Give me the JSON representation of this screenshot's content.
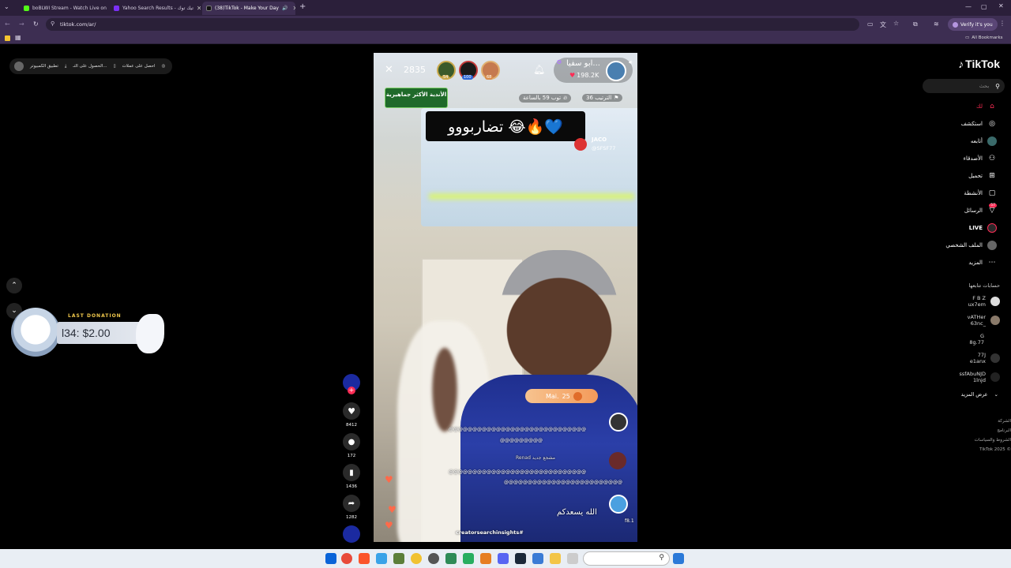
{
  "browser": {
    "tabs": [
      {
        "title": "boBLWI Stream - Watch Live on",
        "fav_color": "#53fc18"
      },
      {
        "title": "Yahoo Search Results - تيك توك",
        "fav_color": "#7b2ff7"
      },
      {
        "title": "(38)TikTok - Make Your Day",
        "fav_color": "#111111"
      }
    ],
    "url": "tiktok.com/ar/",
    "verify_label": "Verify it's you",
    "all_bookmarks": "All Bookmarks"
  },
  "top_actions": {
    "points": "احصل على عملات",
    "get_app": "الحصول على التـ...",
    "desktop_app": "تطبيق الكمبيوتر"
  },
  "donation": {
    "title": "LAST DONATION",
    "amount": "l34: $2.00"
  },
  "sidebar": {
    "brand": "TikTok",
    "search_placeholder": "بحث",
    "nav": [
      {
        "label": "لك",
        "icon": "home-icon"
      },
      {
        "label": "استكشف",
        "icon": "compass-icon"
      },
      {
        "label": "أتابعه",
        "icon": "following-icon"
      },
      {
        "label": "الأصدقاء",
        "icon": "friends-icon"
      },
      {
        "label": "تحميل",
        "icon": "upload-icon"
      },
      {
        "label": "الأنشطة",
        "icon": "activity-icon"
      },
      {
        "label": "الرسائل",
        "icon": "messages-icon"
      },
      {
        "label": "LIVE",
        "icon": "live-icon"
      },
      {
        "label": "الملف الشخصي",
        "icon": "profile-icon"
      },
      {
        "label": "المزيد",
        "icon": "more-icon"
      }
    ],
    "following_title": "حسابات تتابعها",
    "following": [
      {
        "name": "F B Z",
        "handle": "ux7em"
      },
      {
        "name": "vATHer",
        "handle": "63nc_"
      },
      {
        "name": "G",
        "handle": "8g.77"
      },
      {
        "name": "77J",
        "handle": "e1anx"
      },
      {
        "name": "ssfAbuNJD",
        "handle": "1lnjd"
      }
    ],
    "see_more": "عرض المزيد",
    "footer": [
      "الشركة",
      "البرنامج",
      "الشروط والسياسات",
      "TikTok 2025 ©"
    ],
    "badge_messages": "57"
  },
  "live": {
    "host_name": "ابو سفيا...",
    "host_likes": "198.2K",
    "viewers": "2835",
    "top_badges": [
      "54",
      "100",
      "68"
    ],
    "rank_label": "الترتيب 36",
    "hour_label": "توب 59 بالساعة",
    "club_badge": "الأندية الأكثر جماهيرية",
    "banner_text": "تضاربووو 😂🔥💙",
    "jaco_name": "JACO",
    "jaco_handle": "@SFSF77",
    "gift_label": "Mai.",
    "gift_count": "25",
    "chat": [
      {
        "text": "@@@@@@@@@@@@@@@@@@@@@@@@@@@@@"
      },
      {
        "text": "@@@@@@@@@"
      },
      {
        "text": "Renad  مشجع جديد"
      },
      {
        "text": "@@@@@@@@@@@@@@@@@@@@@@@@@@@@@"
      },
      {
        "text": "@@@@@@@@@@@@@@@@@@@@@@@@@"
      },
      {
        "text": "الله يسعدكم"
      },
      {
        "text": "f8.1"
      }
    ],
    "hashtag": "creatorsearchinsights#"
  },
  "actions": {
    "likes": "8412",
    "comments": "172",
    "saves": "1436",
    "shares": "1282"
  }
}
